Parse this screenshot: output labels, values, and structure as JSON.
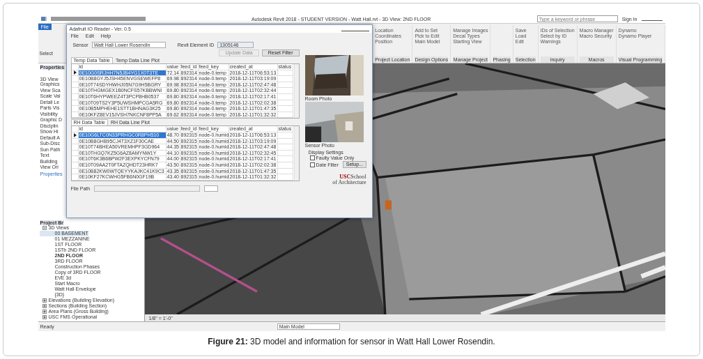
{
  "revit": {
    "title": "Autodesk Revit 2018 - STUDENT VERSION -    Watt Hall.rvt - 3D View: 2ND FLOOR",
    "search": {
      "placeholder": "Type a keyword or phrase"
    },
    "sign_in": "Sign In",
    "file_tab": "File",
    "select_label": "Select",
    "ribbon_panels": [
      {
        "label": "Project Location",
        "items": [
          "Location",
          "Coordinates",
          "Position"
        ]
      },
      {
        "label": "Design Options",
        "items": [
          "Add to Set",
          "Pick to Edit",
          "Main Model"
        ]
      },
      {
        "label": "Manage Project",
        "items": [
          "Manage Images",
          "Decal Types",
          "Starting View"
        ]
      },
      {
        "label": "Phasing"
      },
      {
        "label": "Selection",
        "items": [
          "Save",
          "Load",
          "Edit"
        ]
      },
      {
        "label": "Inquiry",
        "items": [
          "IDs of Selection",
          "Select by ID",
          "Warnings"
        ]
      },
      {
        "label": "Macros",
        "items": [
          "Macro Manager",
          "Macro Security"
        ]
      },
      {
        "label": "Visual Programming",
        "items": [
          "Dynamo",
          "Dynamo Player"
        ]
      }
    ],
    "properties": {
      "title": "Properties",
      "view_type": "3D View",
      "rows": [
        "Graphics",
        "View Sca",
        "Scale Val",
        "Detail Le",
        "Parts Vis",
        "Visibility",
        "Graphic D",
        "Disciplin",
        "Show Hi",
        "Default A",
        "Sub-Disc",
        "Sun Path",
        "Text",
        "Building",
        "View Ori"
      ],
      "help_link": "Properties"
    },
    "project_browser": {
      "title": "Project Br",
      "tree": [
        {
          "label": "3D Views",
          "expanded": true,
          "children": [
            {
              "label": "00 BASEMENT",
              "selected": true,
              "current": false
            },
            {
              "label": "01 MEZZANINE",
              "selected": false,
              "current": false
            },
            {
              "label": "1ST FLOOR",
              "selected": false,
              "current": false
            },
            {
              "label": "1STb 2ND FLOOR",
              "selected": false,
              "current": false
            },
            {
              "label": "2ND FLOOR",
              "selected": false,
              "current": true
            },
            {
              "label": "3RD FLOOR",
              "selected": false,
              "current": false
            },
            {
              "label": "Construction Phases",
              "selected": false,
              "current": false
            },
            {
              "label": "Copy of 3RD FLOOR",
              "selected": false,
              "current": false
            },
            {
              "label": "EVE 3d",
              "selected": false,
              "current": false
            },
            {
              "label": "Start Macro",
              "selected": false,
              "current": false
            },
            {
              "label": "Watt Hall Envelope",
              "selected": false,
              "current": false
            },
            {
              "label": "{3D}",
              "selected": false,
              "current": false
            }
          ]
        },
        {
          "label": "Elevations (Building Elevation)",
          "expanded": false
        },
        {
          "label": "Sections (Building Section)",
          "expanded": false
        },
        {
          "label": "Area Plans (Gross Building)",
          "expanded": false
        },
        {
          "label": "USC FMS Operational",
          "expanded": false
        }
      ]
    },
    "view_scale": "1/8\" = 1'-0\"",
    "status": "Ready",
    "status_model": "Main Model"
  },
  "dialog": {
    "title": "Adafruit IO Reader - Ver. 0.5",
    "menu": [
      "File",
      "Edit",
      "Help"
    ],
    "sensor_label": "Sensor",
    "sensor_value": "Watt Hall Lower Rosendin",
    "element_id_label": "Revit Element ID",
    "element_id": "1305146",
    "buttons": [
      {
        "label": "Update Data",
        "disabled": true
      },
      {
        "label": "Reset Filter",
        "disabled": false
      }
    ],
    "tables": [
      {
        "tabs": [
          {
            "label": "Temp Data Table",
            "selected": true
          },
          {
            "label": "Temp Data Line Plot",
            "selected": false
          }
        ],
        "columns": [
          "id",
          "value",
          "feed_id",
          "feed_key",
          "created_at",
          "status"
        ],
        "rows": [
          {
            "selected": true,
            "cells": [
              "0E10G0SRJHH7N5JB4YG1X0T3TE",
              "72.14",
              "892314",
              "node-0.temp",
              "2018-12-11T06:53:13",
              ""
            ]
          },
          {
            "selected": false,
            "cells": [
              "0E10B8GYJ5JSH45ENVGSEWEFP8",
              "69.98",
              "892314",
              "node-0.temp",
              "2018-12-11T03:19:09",
              ""
            ]
          },
          {
            "selected": false,
            "cells": [
              "0E10T74SDYHWHJ05N7G9H5BGRY",
              "69.98",
              "892314",
              "node-0.temp",
              "2018-12-11T02:47:48",
              ""
            ]
          },
          {
            "selected": false,
            "cells": [
              "0E10THGMGEX1B0NCFS57KBBWNI",
              "69.80",
              "892314",
              "node-0.temp",
              "2018-12-11T02:32:44",
              ""
            ]
          },
          {
            "selected": false,
            "cells": [
              "0E10T6HYPWEEZ4T3PCP8HB0537",
              "69.80",
              "892314",
              "node-0.temp",
              "2018-12-11T02:17:41",
              ""
            ]
          },
          {
            "selected": false,
            "cells": [
              "0E10T09TS2Y3P5UWSHMPCGA5RG",
              "69.80",
              "892314",
              "node-0.temp",
              "2018-12-11T02:02:38",
              ""
            ]
          },
          {
            "selected": false,
            "cells": [
              "0E10B5MPHEHE1STT1BHNAG3K25",
              "69.80",
              "892314",
              "node-0.temp",
              "2018-12-11T01:47:35",
              ""
            ]
          },
          {
            "selected": false,
            "cells": [
              "0E10KFZ8EV15JVSH7NKCNF8PP5A",
              "69.62",
              "892314",
              "node-0.temp",
              "2018-12-11T01:32:32",
              ""
            ]
          }
        ]
      },
      {
        "tabs": [
          {
            "label": "RH Data Table",
            "selected": true
          },
          {
            "label": "RH Data Line Plot",
            "selected": false
          }
        ],
        "columns": [
          "id",
          "value",
          "feed_id",
          "feed_key",
          "created_at",
          "status"
        ],
        "rows": [
          {
            "selected": true,
            "cells": [
              "0E10G6LTC0N33PRHGC0R8PH510",
              "48.70",
              "892315",
              "node-0.humid",
              "2018-12-11T06:53:13",
              ""
            ]
          },
          {
            "selected": false,
            "cells": [
              "0E10B8GHB95CJ4T3XZ1F30CAE",
              "44.50",
              "892315",
              "node-0.humid",
              "2018-12-11T03:19:09",
              ""
            ]
          },
          {
            "selected": false,
            "cells": [
              "0E10T74BHEA50VREMHPF3GD964",
              "44.35",
              "892315",
              "node-0.humid",
              "2018-12-11T02:47:48",
              ""
            ]
          },
          {
            "selected": false,
            "cells": [
              "0E10THGQ7KZ5G6AZ8AMYNW1Y",
              "44.10",
              "892315",
              "node-0.humid",
              "2018-12-11T02:32:45",
              ""
            ]
          },
          {
            "selected": false,
            "cells": [
              "0E10T6K3B6BPW2F3EXPKYCFN79",
              "44.00",
              "892315",
              "node-0.humid",
              "2018-12-11T02:17:41",
              ""
            ]
          },
          {
            "selected": false,
            "cells": [
              "0E10T09AA2T0FTAZQHDT23HRK7",
              "43.50",
              "892315",
              "node-0.humid",
              "2018-12-11T02:02:38",
              ""
            ]
          },
          {
            "selected": false,
            "cells": [
              "0E10B82KW0WTQEYYKAJKC41K9C3",
              "43.35",
              "892315",
              "node-0.humid",
              "2018-12-11T01:47:35",
              ""
            ]
          },
          {
            "selected": false,
            "cells": [
              "0E10KF27KCWHG5FB6N0GF19B",
              "43.40",
              "892315",
              "node-0.humid",
              "2018-12-11T01:32:32",
              ""
            ]
          }
        ]
      }
    ],
    "room_photo_label": "Room Photo",
    "sensor_photo_label": "Sensor Photo",
    "display_settings": "Display Settings",
    "checkboxes": [
      {
        "label": "Faulty Value Only",
        "checked": false
      },
      {
        "label": "Date Filter",
        "checked": false
      }
    ],
    "setup_button": "Setup...",
    "file_path_label": "File Path",
    "logo": {
      "usc": "USC",
      "school": "School",
      "line2": "of Architecture"
    }
  },
  "caption": {
    "label": "Figure 21:",
    "text": "3D model and information for sensor in Watt Hall Lower Rosendin."
  }
}
